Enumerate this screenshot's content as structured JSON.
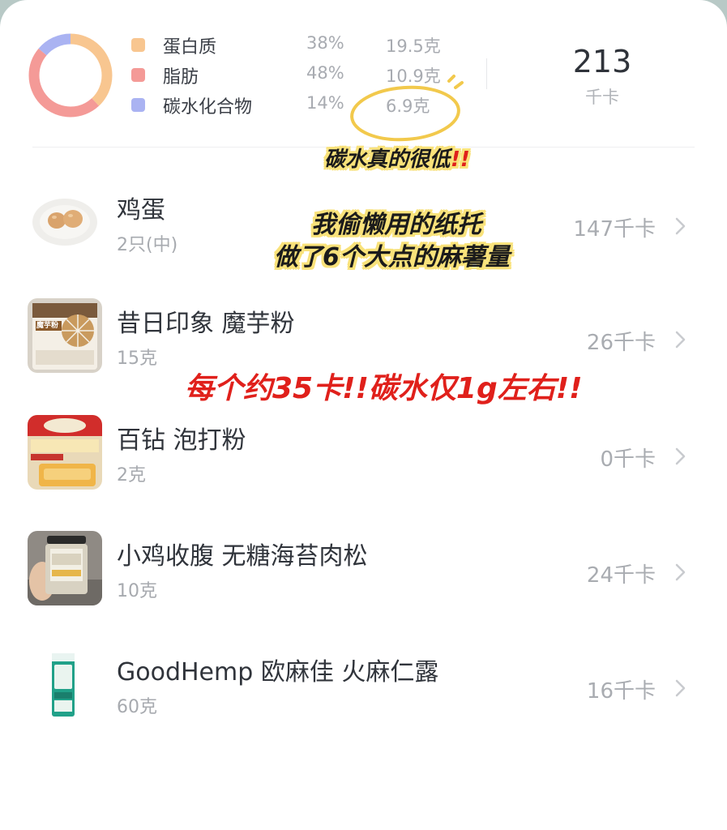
{
  "summary": {
    "macros": [
      {
        "name": "蛋白质",
        "percent": "38%",
        "grams": "19.5克",
        "color": "#f8c690"
      },
      {
        "name": "脂肪",
        "percent": "48%",
        "grams": "10.9克",
        "color": "#f49a97"
      },
      {
        "name": "碳水化合物",
        "percent": "14%",
        "grams": "6.9克",
        "color": "#aab3f2"
      }
    ],
    "total_kcal": "213",
    "total_unit": "千卡"
  },
  "foods": [
    {
      "name": "鸡蛋",
      "qty": "2只(中)",
      "kcal": "147千卡",
      "icon": "egg-plate-icon"
    },
    {
      "name": "昔日印象 魔芋粉",
      "qty": "15克",
      "kcal": "26千卡",
      "icon": "konjac-flour-package-icon",
      "package_text": "魔芋粉"
    },
    {
      "name": "百钻 泡打粉",
      "qty": "2克",
      "kcal": "0千卡",
      "icon": "baking-powder-package-icon"
    },
    {
      "name": "小鸡收腹 无糖海苔肉松",
      "qty": "10克",
      "kcal": "24千卡",
      "icon": "meat-floss-jar-icon"
    },
    {
      "name": "GoodHemp 欧麻佳 火麻仁露",
      "qty": "60克",
      "kcal": "16千卡",
      "icon": "hemp-milk-carton-icon"
    }
  ],
  "annotations": {
    "carb_note": "碳水真的很低",
    "carb_bang": "!!",
    "mold_line1": "我偷懒用的纸托",
    "mold_line2": "做了6个大点的麻薯量",
    "calorie_note": "每个约35卡!!碳水仅1g左右!!"
  }
}
